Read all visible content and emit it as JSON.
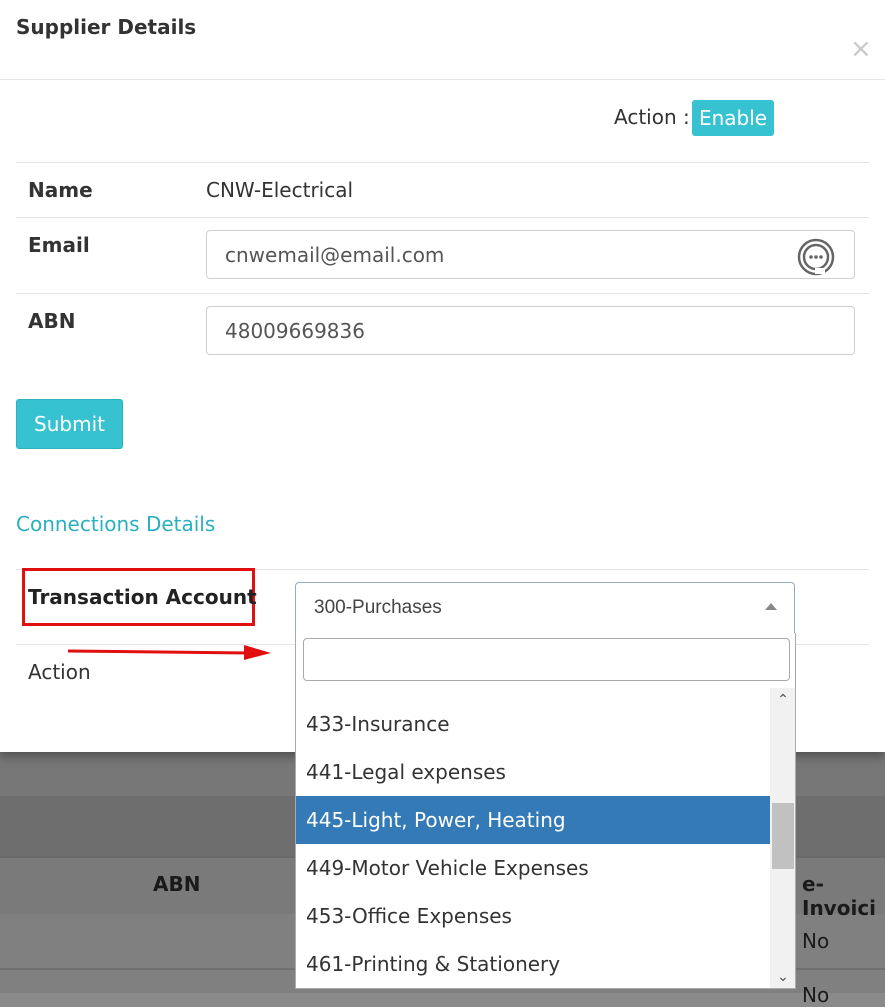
{
  "modal": {
    "title": "Supplier Details",
    "close_glyph": "×",
    "action_label": "Action :",
    "action_badge": "Enable"
  },
  "fields": {
    "name_label": "Name",
    "name_value": "CNW-Electrical",
    "email_label": "Email",
    "email_value": "cnwemail@email.com",
    "abn_label": "ABN",
    "abn_value": "48009669836"
  },
  "submit_label": "Submit",
  "connections": {
    "title": "Connections Details",
    "transaction_label": "Transaction Account",
    "action_label": "Action",
    "selected_value": "300-Purchases",
    "search_value": "",
    "options": [
      "433-Insurance",
      "441-Legal expenses",
      "445-Light, Power, Heating",
      "449-Motor Vehicle Expenses",
      "453-Office Expenses",
      "461-Printing & Stationery"
    ],
    "highlighted_option": "445-Light, Power, Heating"
  },
  "background_table": {
    "col_abn": "ABN",
    "col_einvoicing": "e-Invoici",
    "rows": [
      "No",
      "No"
    ]
  },
  "colors": {
    "accent": "#36c2d1",
    "section_title": "#2bb0c0",
    "highlight": "#337ab7",
    "annotation_red": "#e01010"
  },
  "icons": {
    "email_field_icon": "chat-bubble-icon",
    "dropdown_caret": "caret-up-icon",
    "scroll_up": "chevron-up-icon",
    "scroll_down": "chevron-down-icon"
  }
}
